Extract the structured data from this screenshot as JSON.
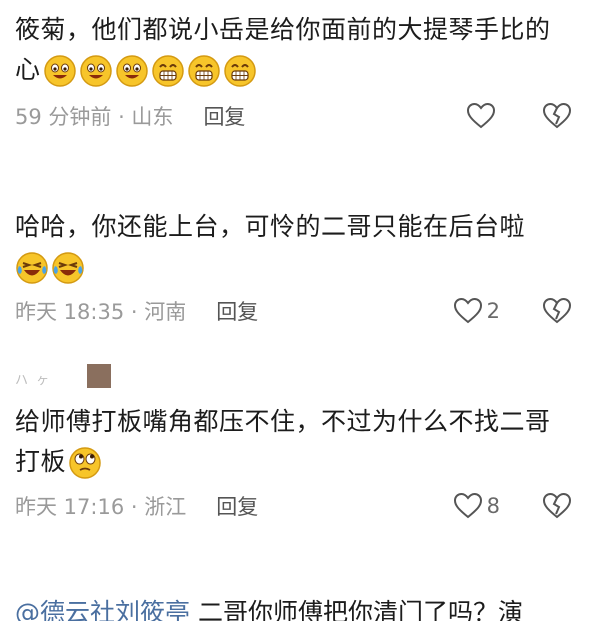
{
  "comments": [
    {
      "text": "筱菊，他们都说小岳是给你面前的大提琴手比的心",
      "emojis": [
        "smile-face-emoji",
        "smile-face-emoji",
        "smile-face-emoji",
        "grin-face-emoji",
        "grin-face-emoji",
        "grin-face-emoji"
      ],
      "time": "59 分钟前 · 山东",
      "reply_label": "回复",
      "likes": ""
    },
    {
      "text": "哈哈，你还能上台，可怜的二哥只能在后台啦",
      "emojis": [
        "laugh-cry-emoji",
        "laugh-cry-emoji"
      ],
      "time": "昨天 18:35 · 河南",
      "reply_label": "回复",
      "likes": "2"
    },
    {
      "text": "给师傅打板嘴角都压不住，不过为什么不找二哥打板",
      "emojis": [
        "rolling-eyes-emoji"
      ],
      "time": "昨天 17:16 · 浙江",
      "reply_label": "回复",
      "likes": "8"
    }
  ],
  "user_stub": {
    "name": "ハ ヶ"
  },
  "partial_comment": {
    "mention": "@德云社刘筱亭",
    "text": " 二哥你师傅把你清门了吗？演"
  },
  "colors": {
    "text": "#1c1c1c",
    "meta": "#9a9a9a",
    "mention": "#4a6fa0",
    "emoji_face": "#f7c52a"
  }
}
